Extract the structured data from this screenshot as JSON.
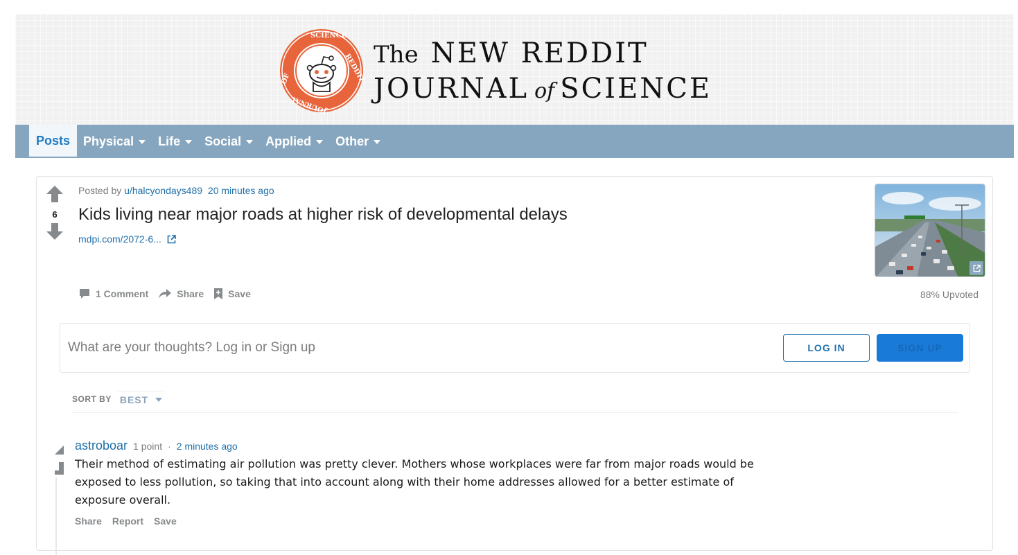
{
  "banner": {
    "brand_the": "The",
    "brand_new_reddit": "NEW REDDIT",
    "brand_journal": "JOURNAL",
    "brand_of": "of",
    "brand_science": "SCIENCE",
    "emblem_ring_text": "NEW · REDDIT · JOURNAL · OF · SCIENCE"
  },
  "nav": {
    "items": [
      {
        "label": "Posts",
        "active": true
      },
      {
        "label": "Physical"
      },
      {
        "label": "Life"
      },
      {
        "label": "Social"
      },
      {
        "label": "Applied"
      },
      {
        "label": "Other"
      }
    ]
  },
  "post": {
    "score": "6",
    "posted_by_prefix": "Posted by",
    "author": "u/halcyondays489",
    "time": "20 minutes ago",
    "title": "Kids living near major roads at higher risk of developmental delays",
    "link_text": "mdpi.com/2072-6...",
    "comments_label": "1 Comment",
    "share_label": "Share",
    "save_label": "Save",
    "upvoted_label": "88% Upvoted"
  },
  "comment_box": {
    "prompt": "What are your thoughts? Log in or Sign up",
    "login_label": "LOG IN",
    "signup_label": "SIGN UP"
  },
  "sort": {
    "label": "SORT BY",
    "value": "BEST"
  },
  "comments": [
    {
      "author": "astroboar",
      "points": "1 point",
      "separator": "·",
      "time": "2 minutes ago",
      "body": "Their method of estimating air pollution was pretty clever. Mothers whose workplaces were far from major roads would be exposed to less pollution, so taking that into account along with their home addresses allowed for a better estimate of exposure overall.",
      "actions": {
        "share": "Share",
        "report": "Report",
        "save": "Save"
      }
    }
  ],
  "colors": {
    "nav_bg": "#86a6bf",
    "accent_blue": "#1f6fa8",
    "emblem_orange": "#e8643b",
    "signup_bg": "#1a7ad7"
  }
}
